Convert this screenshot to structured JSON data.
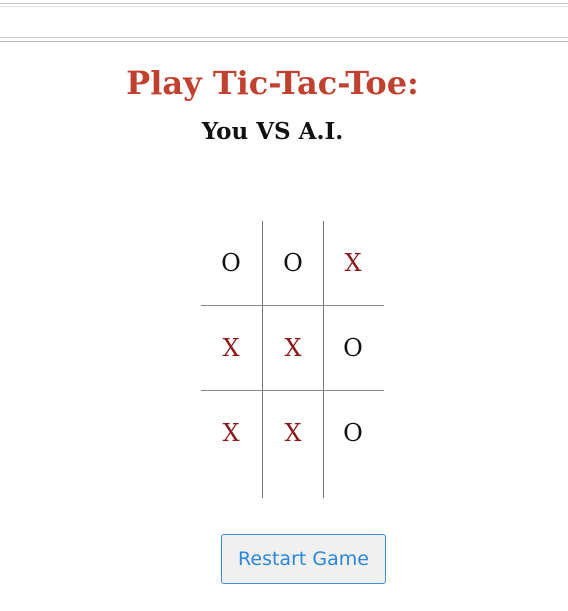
{
  "header": {
    "title": "Play Tic-Tac-Toe:",
    "subtitle": "You VS A.I."
  },
  "board": {
    "cells": [
      "O",
      "O",
      "X",
      "X",
      "X",
      "O",
      "X",
      "X",
      "O"
    ]
  },
  "controls": {
    "restart_label": "Restart Game"
  },
  "colors": {
    "title": "#c0412f",
    "x_mark": "#8b1a1a",
    "o_mark": "#111111",
    "button_text": "#2b86d6",
    "button_border": "#3a8fd8"
  }
}
